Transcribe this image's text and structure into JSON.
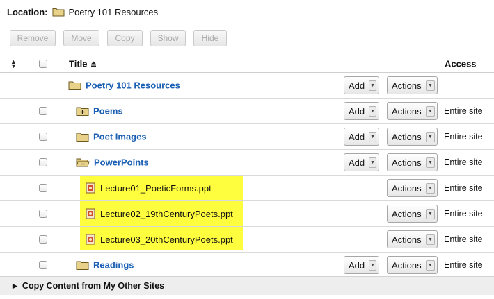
{
  "location": {
    "label": "Location:",
    "folder_icon": "folder-icon",
    "path": "Poetry 101 Resources"
  },
  "toolbar": {
    "remove_label": "Remove",
    "move_label": "Move",
    "copy_label": "Copy",
    "show_label": "Show",
    "hide_label": "Hide"
  },
  "table": {
    "header": {
      "sort_icon": "sort-arrows-icon",
      "title": "Title",
      "title_sort_icon": "sort-ascending-icon",
      "access": "Access"
    },
    "rows": [
      {
        "name": "Poetry 101 Resources",
        "kind": "folder",
        "icon": "folder-icon",
        "add": "Add",
        "actions": "Actions",
        "access": ""
      },
      {
        "name": "Poems",
        "kind": "folder",
        "icon": "folder-expand-icon",
        "add": "Add",
        "actions": "Actions",
        "access": "Entire site"
      },
      {
        "name": "Poet Images",
        "kind": "folder",
        "icon": "folder-icon",
        "add": "Add",
        "actions": "Actions",
        "access": "Entire site"
      },
      {
        "name": "PowerPoints",
        "kind": "folder",
        "icon": "folder-open-icon",
        "add": "Add",
        "actions": "Actions",
        "access": "Entire site"
      },
      {
        "name": "Lecture01_PoeticForms.ppt",
        "kind": "file",
        "icon": "ppt-file-icon",
        "add": "",
        "actions": "Actions",
        "access": "Entire site"
      },
      {
        "name": "Lecture02_19thCenturyPoets.ppt",
        "kind": "file",
        "icon": "ppt-file-icon",
        "add": "",
        "actions": "Actions",
        "access": "Entire site"
      },
      {
        "name": "Lecture03_20thCenturyPoets.ppt",
        "kind": "file",
        "icon": "ppt-file-icon",
        "add": "",
        "actions": "Actions",
        "access": "Entire site"
      },
      {
        "name": "Readings",
        "kind": "folder",
        "icon": "folder-icon",
        "add": "Add",
        "actions": "Actions",
        "access": "Entire site"
      }
    ]
  },
  "footer": {
    "label": "Copy Content from My Other Sites"
  },
  "colors": {
    "link": "#1a5fb4",
    "highlight": "#fefe3f",
    "folder": "#e8d28a"
  }
}
